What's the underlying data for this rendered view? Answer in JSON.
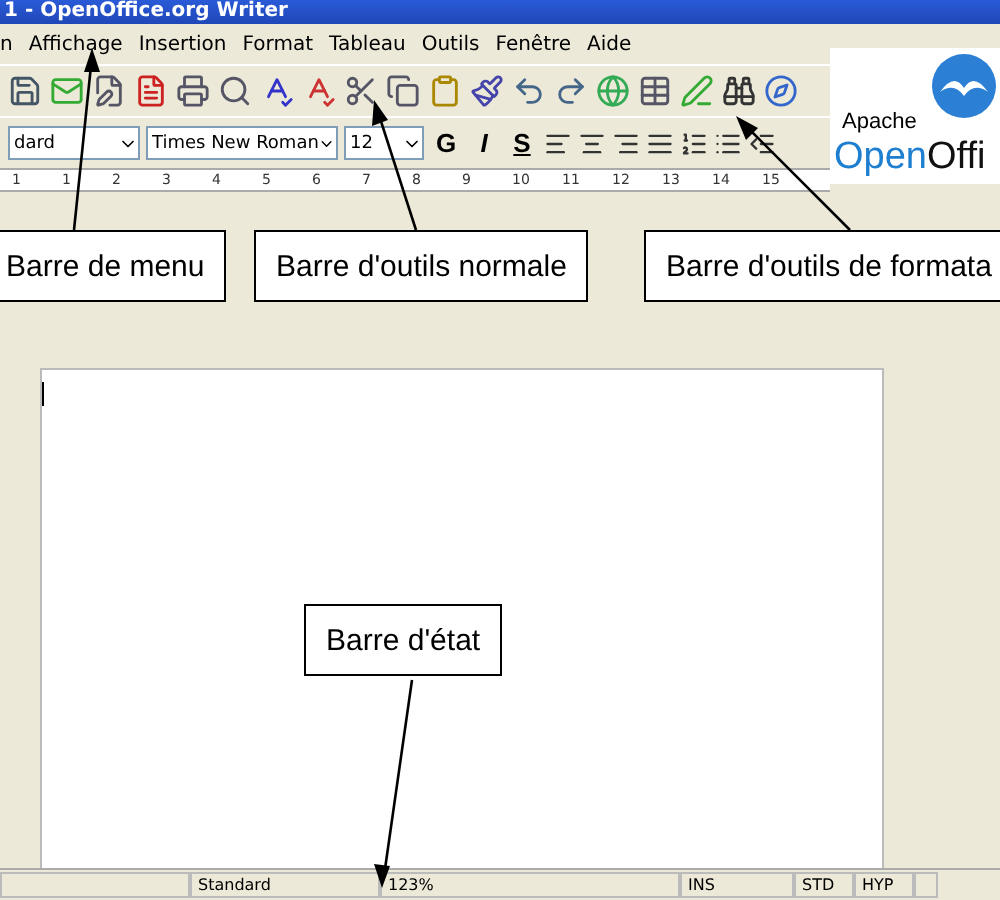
{
  "window": {
    "title": "1 - OpenOffice.org Writer"
  },
  "menu": [
    "n",
    "Affichage",
    "Insertion",
    "Format",
    "Tableau",
    "Outils",
    "Fenêtre",
    "Aide"
  ],
  "formatting": {
    "style": "dard",
    "font": "Times New Roman",
    "size": "12",
    "bold": "G",
    "italic": "I",
    "shadow": "S"
  },
  "ruler": [
    "1",
    "1",
    "2",
    "3",
    "4",
    "5",
    "6",
    "7",
    "8",
    "9",
    "10",
    "11",
    "12",
    "13",
    "14",
    "15"
  ],
  "logo": {
    "line1": "Apache",
    "line2": [
      "Open",
      "Offi"
    ]
  },
  "callouts": [
    "Barre de menu",
    "Barre d'outils normale",
    "Barre d'outils de formata",
    "Barre d'état"
  ],
  "status_bar": [
    "Standard",
    "123%",
    "INS",
    "STD",
    "HYP"
  ]
}
